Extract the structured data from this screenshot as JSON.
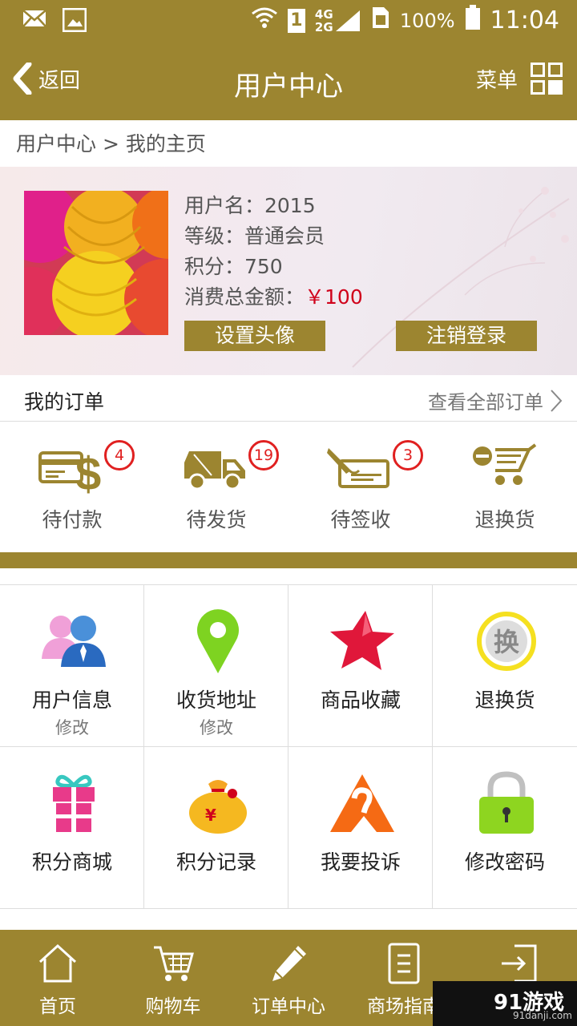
{
  "status_bar": {
    "battery_pct": "100%",
    "time": "11:04",
    "network": "4G",
    "network2": "2G",
    "sim": "1"
  },
  "header": {
    "back_label": "返回",
    "title": "用户中心",
    "menu_label": "菜单"
  },
  "breadcrumb": "用户中心 > 我的主页",
  "profile": {
    "username": "用户名：2015",
    "level": "等级：普通会员",
    "points": "积分：750",
    "spent_label": "消费总金额：",
    "spent_value": "￥100",
    "set_avatar": "设置头像",
    "logout": "注销登录"
  },
  "orders": {
    "title": "我的订单",
    "view_all": "查看全部订单",
    "items": [
      {
        "label": "待付款",
        "count": "4",
        "icon": "payment-card-icon"
      },
      {
        "label": "待发货",
        "count": "19",
        "icon": "truck-icon"
      },
      {
        "label": "待签收",
        "count": "3",
        "icon": "sign-icon"
      },
      {
        "label": "退换货",
        "count": "",
        "icon": "cart-return-icon"
      }
    ]
  },
  "grid": {
    "items": [
      {
        "label": "用户信息",
        "sub": "修改",
        "icon": "users-icon"
      },
      {
        "label": "收货地址",
        "sub": "修改",
        "icon": "location-pin-icon"
      },
      {
        "label": "商品收藏",
        "sub": "",
        "icon": "star-icon"
      },
      {
        "label": "退换货",
        "sub": "",
        "icon": "exchange-icon",
        "badge_char": "换"
      },
      {
        "label": "积分商城",
        "sub": "",
        "icon": "gift-icon"
      },
      {
        "label": "积分记录",
        "sub": "",
        "icon": "money-bag-icon"
      },
      {
        "label": "我要投诉",
        "sub": "",
        "icon": "complaint-icon"
      },
      {
        "label": "修改密码",
        "sub": "",
        "icon": "lock-icon"
      }
    ]
  },
  "bottom_nav": {
    "items": [
      {
        "label": "首页",
        "icon": "home-icon"
      },
      {
        "label": "购物车",
        "icon": "cart-icon"
      },
      {
        "label": "订单中心",
        "icon": "pencil-icon"
      },
      {
        "label": "商场指南",
        "icon": "document-icon"
      },
      {
        "label": "",
        "icon": "login-icon"
      }
    ]
  },
  "watermark": {
    "main": "91游戏",
    "sub": "91danji.com"
  },
  "colors": {
    "brand": "#9c8530",
    "badge": "#e02020",
    "price": "#d0021b"
  }
}
